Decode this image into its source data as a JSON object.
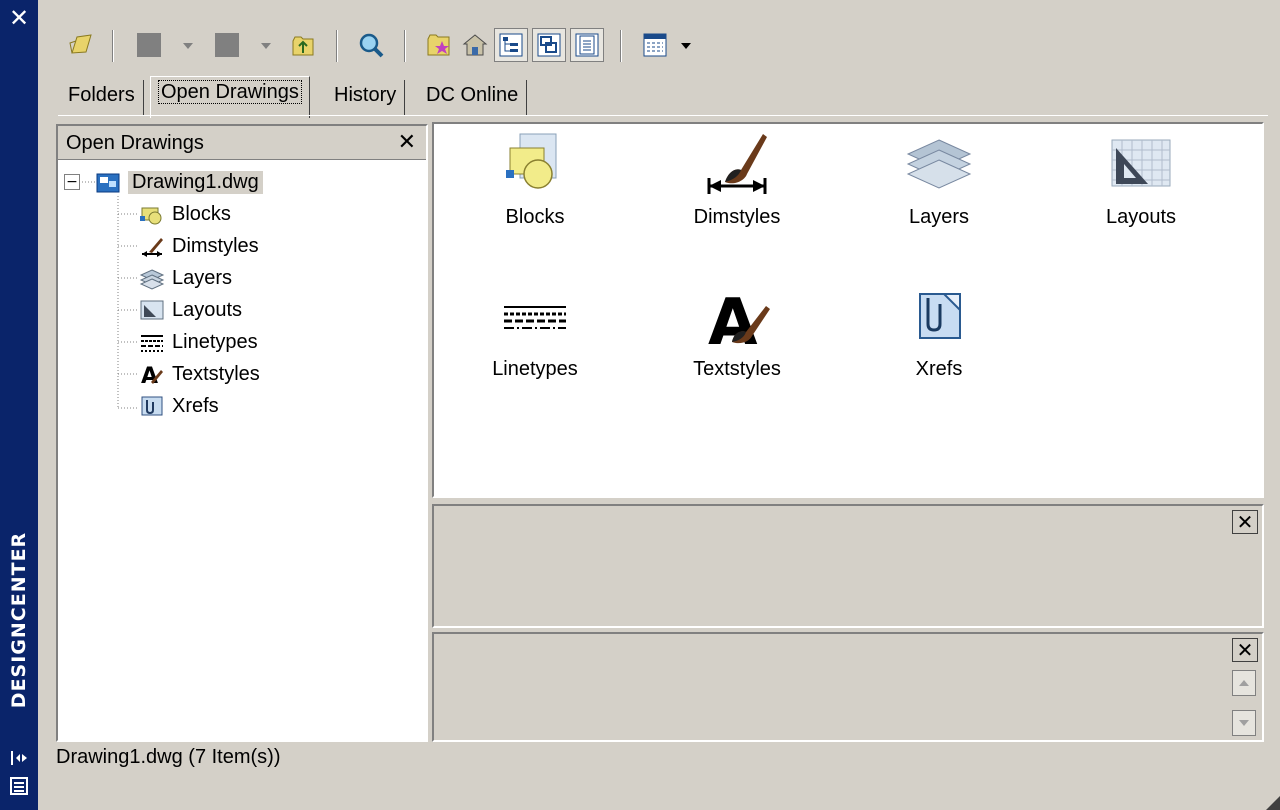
{
  "palette": {
    "titlebar": "#0a246a",
    "face": "#d4d0c8",
    "highlight": "#d4d0c8"
  },
  "titlebar": {
    "title": "DESIGNCENTER",
    "close_icon": "close-icon"
  },
  "toolbar": {
    "buttons": [
      {
        "name": "load-button",
        "icon": "folder-open-icon"
      },
      {
        "name": "back-button",
        "icon": "back-icon"
      },
      {
        "name": "forward-button",
        "icon": "forward-icon"
      },
      {
        "name": "up-button",
        "icon": "up-folder-icon"
      },
      {
        "name": "search-button",
        "icon": "search-icon"
      },
      {
        "name": "favorites-button",
        "icon": "favorites-icon"
      },
      {
        "name": "home-button",
        "icon": "home-icon"
      },
      {
        "name": "tree-toggle-button",
        "icon": "tree-view-icon"
      },
      {
        "name": "preview-button",
        "icon": "preview-icon"
      },
      {
        "name": "description-button",
        "icon": "description-icon"
      },
      {
        "name": "views-button",
        "icon": "views-icon"
      }
    ]
  },
  "tabs": [
    {
      "label": "Folders"
    },
    {
      "label": "Open Drawings",
      "active": true
    },
    {
      "label": "History"
    },
    {
      "label": "DC Online"
    }
  ],
  "tree": {
    "header": "Open Drawings",
    "root": {
      "label": "Drawing1.dwg",
      "expander": "⊟"
    },
    "children": [
      {
        "label": "Blocks",
        "icon": "blocks-icon"
      },
      {
        "label": "Dimstyles",
        "icon": "dimstyles-icon"
      },
      {
        "label": "Layers",
        "icon": "layers-icon"
      },
      {
        "label": "Layouts",
        "icon": "layouts-icon"
      },
      {
        "label": "Linetypes",
        "icon": "linetypes-icon"
      },
      {
        "label": "Textstyles",
        "icon": "textstyles-icon"
      },
      {
        "label": "Xrefs",
        "icon": "xrefs-icon"
      }
    ]
  },
  "content": {
    "items": [
      {
        "label": "Blocks",
        "icon": "blocks-icon"
      },
      {
        "label": "Dimstyles",
        "icon": "dimstyles-icon"
      },
      {
        "label": "Layers",
        "icon": "layers-icon"
      },
      {
        "label": "Layouts",
        "icon": "layouts-icon"
      },
      {
        "label": "Linetypes",
        "icon": "linetypes-icon"
      },
      {
        "label": "Textstyles",
        "icon": "textstyles-icon"
      },
      {
        "label": "Xrefs",
        "icon": "xrefs-icon"
      }
    ]
  },
  "status": {
    "text": "Drawing1.dwg (7 Item(s))"
  }
}
